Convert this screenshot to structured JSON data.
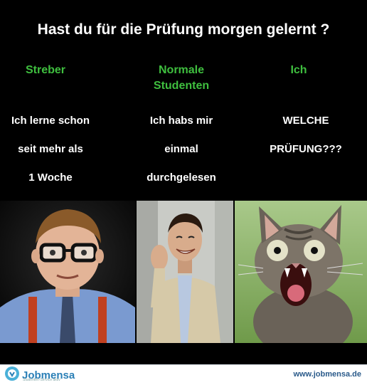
{
  "title": "Hast du für die Prüfung morgen gelernt ?",
  "columns": [
    {
      "heading": "Streber",
      "lines": [
        "Ich lerne schon",
        "seit   mehr als",
        "1 Woche"
      ]
    },
    {
      "heading_lines": [
        "Normale",
        "Studenten"
      ],
      "lines": [
        "Ich habs mir",
        "einmal",
        "durchgelesen"
      ]
    },
    {
      "heading": "Ich",
      "lines": [
        "WELCHE",
        "PRÜFUNG???"
      ]
    }
  ],
  "footer": {
    "logo_text": "Jobmensa",
    "logo_tagline": "Studenten-Service aktiv",
    "website": "www.jobmensa.de"
  },
  "colors": {
    "background": "#000000",
    "heading_green": "#3fbf3f",
    "text": "#ffffff",
    "logo_blue": "#2a7fb6"
  },
  "images": [
    {
      "name": "nerd-photo"
    },
    {
      "name": "student-photo"
    },
    {
      "name": "screaming-cat-photo"
    }
  ]
}
